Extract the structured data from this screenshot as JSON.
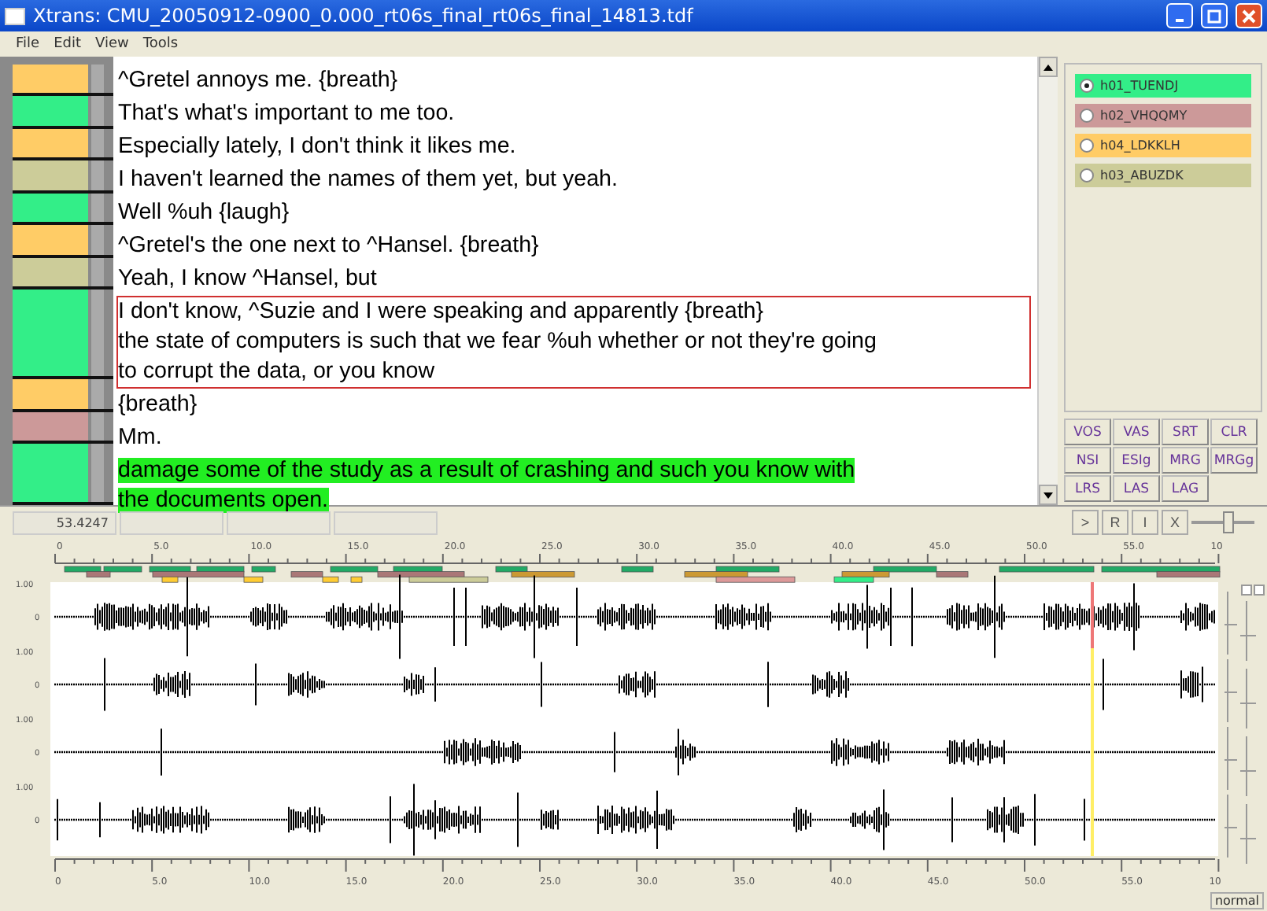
{
  "window": {
    "title": "Xtrans: CMU_20050912-0900_0.000_rt06s_final_rt06s_final_14813.tdf"
  },
  "menu": [
    "File",
    "Edit",
    "View",
    "Tools"
  ],
  "speakers": [
    {
      "id": "h01_TUENDJ",
      "color": "#33ee88",
      "selected": true
    },
    {
      "id": "h02_VHQQMY",
      "color": "#cc9999",
      "selected": false
    },
    {
      "id": "h04_LDKKLH",
      "color": "#ffcc66",
      "selected": false
    },
    {
      "id": "h03_ABUZDK",
      "color": "#cccc99",
      "selected": false
    }
  ],
  "segments": [
    {
      "color": "#ffcc66",
      "lines": [
        "^Gretel annoys me. {breath}"
      ],
      "selected": false,
      "playing": false
    },
    {
      "color": "#33ee88",
      "lines": [
        "That's what's important to me too."
      ],
      "selected": false,
      "playing": false
    },
    {
      "color": "#ffcc66",
      "lines": [
        "Especially lately, I don't think it likes me."
      ],
      "selected": false,
      "playing": false
    },
    {
      "color": "#cccc99",
      "lines": [
        "I haven't learned the names of them yet, but yeah."
      ],
      "selected": false,
      "playing": false
    },
    {
      "color": "#33ee88",
      "lines": [
        "Well %uh {laugh}"
      ],
      "selected": false,
      "playing": false
    },
    {
      "color": "#ffcc66",
      "lines": [
        "^Gretel's the one next to ^Hansel. {breath}"
      ],
      "selected": false,
      "playing": false
    },
    {
      "color": "#cccc99",
      "lines": [
        "Yeah, I know ^Hansel, but"
      ],
      "selected": false,
      "playing": false
    },
    {
      "color": "#33ee88",
      "lines": [
        "I don't know, ^Suzie and I were speaking and apparently {breath}",
        "the state of computers is such that we fear %uh whether or not they're going",
        "to corrupt the data, or you know"
      ],
      "selected": true,
      "playing": false
    },
    {
      "color": "#ffcc66",
      "lines": [
        "{breath}"
      ],
      "selected": false,
      "playing": false
    },
    {
      "color": "#cc9999",
      "lines": [
        "Mm."
      ],
      "selected": false,
      "playing": false
    },
    {
      "color": "#33ee88",
      "lines": [
        "damage some of the study as a result of crashing and such you know with",
        "the documents open."
      ],
      "selected": false,
      "playing": true
    }
  ],
  "buttons": [
    "VOS",
    "VAS",
    "SRT",
    "CLR",
    "NSI",
    "ESIg",
    "MRG",
    "MRGg",
    "LRS",
    "LAS",
    "LAG"
  ],
  "toolbar": {
    "time": "53.4247",
    "controls": [
      ">",
      "R",
      "I",
      "X"
    ],
    "zoom": {
      "level": 0.62
    }
  },
  "timeline": {
    "top_ticks": [
      "0",
      "5.0",
      "10.0",
      "15.0",
      "20.0",
      "25.0",
      "30.0",
      "35.0",
      "40.0",
      "45.0",
      "50.0",
      "55.0",
      "10"
    ],
    "bottom_ticks": [
      "0",
      "5.0",
      "10.0",
      "15.0",
      "20.0",
      "25.0",
      "30.0",
      "35.0",
      "40.0",
      "45.0",
      "50.0",
      "55.0",
      "10"
    ],
    "tracks": [
      {
        "scale": "1.00",
        "zero": "0"
      },
      {
        "scale": "1.00",
        "zero": "0"
      },
      {
        "scale": "1.00",
        "zero": "0"
      },
      {
        "scale": "1.00",
        "zero": "0"
      }
    ]
  },
  "status": "normal"
}
